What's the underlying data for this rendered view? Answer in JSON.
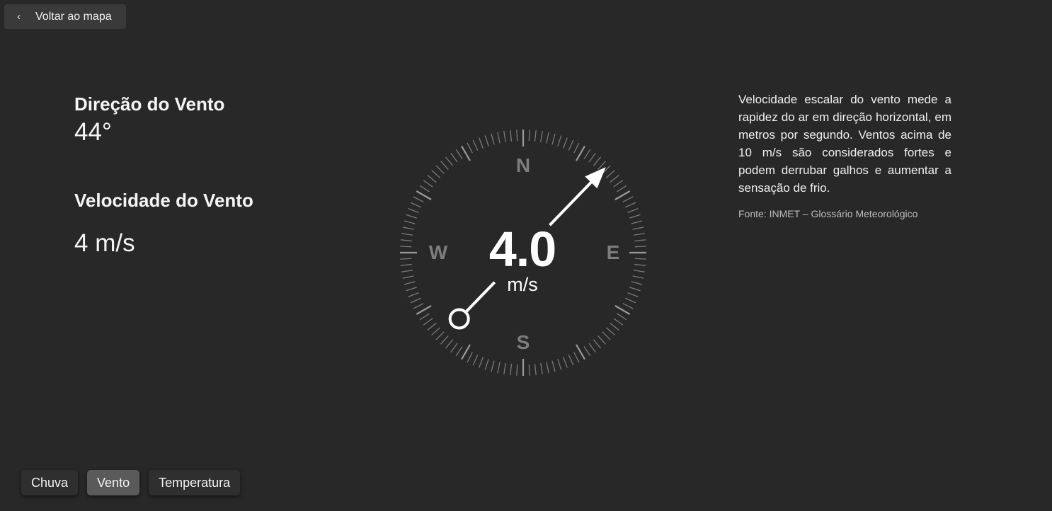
{
  "back": {
    "label": "Voltar ao mapa",
    "icon": "chevron-left-icon"
  },
  "direction": {
    "title": "Direção do Vento",
    "value": "44°",
    "degrees": 44
  },
  "speed": {
    "title": "Velocidade do Vento",
    "value": "4 m/s"
  },
  "compass": {
    "speed_display": "4.0",
    "unit": "m/s",
    "cardinals": {
      "n": "N",
      "e": "E",
      "s": "S",
      "w": "W"
    }
  },
  "info": {
    "description": "Velocidade escalar do vento mede a rapidez do ar em direção horizontal, em metros por segundo. Ventos acima de 10 m/s são considerados fortes e podem derrubar galhos e aumentar a sensação de frio.",
    "source": "Fonte: INMET – Glossário Meteorológico"
  },
  "tabs": [
    {
      "label": "Chuva",
      "active": false
    },
    {
      "label": "Vento",
      "active": true
    },
    {
      "label": "Temperatura",
      "active": false
    }
  ],
  "colors": {
    "background": "#282828",
    "tick": "#8a8a8a",
    "cardinal": "#7d7d7d",
    "arrow": "#ffffff",
    "tab_active": "#5a5a5a"
  }
}
